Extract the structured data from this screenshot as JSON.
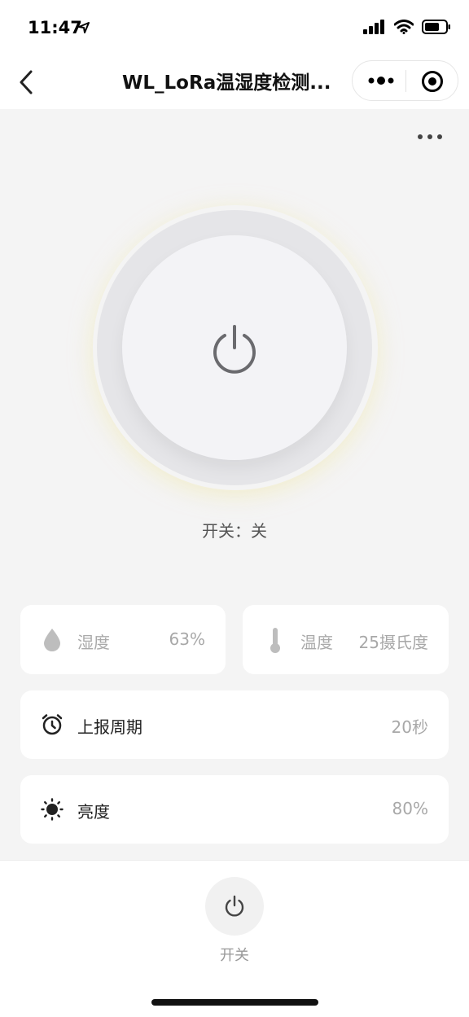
{
  "status_bar": {
    "time": "11:47"
  },
  "nav": {
    "title": "WL_LoRa温湿度检测..."
  },
  "device": {
    "switch_status": "开关：关"
  },
  "cards": {
    "humidity": {
      "label": "湿度",
      "value": "63%"
    },
    "temperature": {
      "label": "温度",
      "value": "25摄氏度"
    },
    "report_period": {
      "label": "上报周期",
      "value": "20秒"
    },
    "brightness": {
      "label": "亮度",
      "value": "80%"
    }
  },
  "bottom_bar": {
    "switch_label": "开关"
  },
  "colors": {
    "background": "#f4f4f4",
    "card": "#ffffff",
    "icon_gray": "#666666",
    "value_gray": "#a8a8a8"
  }
}
